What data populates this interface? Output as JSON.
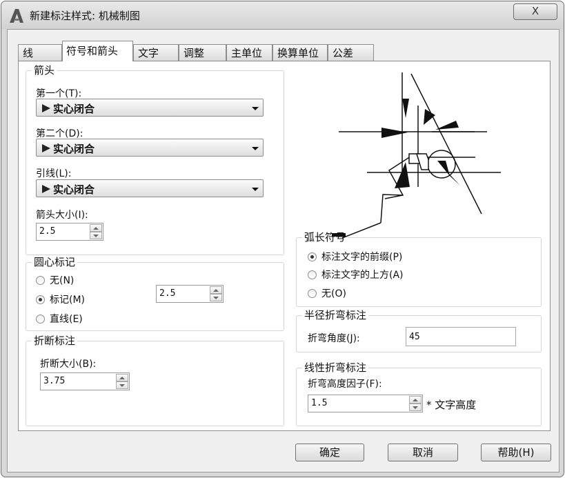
{
  "window": {
    "title": "新建标注样式: 机械制图",
    "close_label": "X"
  },
  "tabs": [
    {
      "label": "线"
    },
    {
      "label": "符号和箭头",
      "active": true
    },
    {
      "label": "文字"
    },
    {
      "label": "调整"
    },
    {
      "label": "主单位"
    },
    {
      "label": "换算单位"
    },
    {
      "label": "公差"
    }
  ],
  "arrowheads": {
    "group_label": "箭头",
    "first_label": "第一个(T):",
    "first_value": "实心闭合",
    "second_label": "第二个(D):",
    "second_value": "实心闭合",
    "leader_label": "引线(L):",
    "leader_value": "实心闭合",
    "size_label": "箭头大小(I):",
    "size_value": "2.5"
  },
  "center_marks": {
    "group_label": "圆心标记",
    "options": [
      {
        "label": "无(N)",
        "selected": false
      },
      {
        "label": "标记(M)",
        "selected": true
      },
      {
        "label": "直线(E)",
        "selected": false
      }
    ],
    "size_value": "2.5"
  },
  "dim_break": {
    "group_label": "折断标注",
    "size_label": "折断大小(B):",
    "size_value": "3.75"
  },
  "arc_length": {
    "group_label": "弧长符号",
    "options": [
      {
        "label": "标注文字的前缀(P)",
        "selected": true
      },
      {
        "label": "标注文字的上方(A)",
        "selected": false
      },
      {
        "label": "无(O)",
        "selected": false
      }
    ]
  },
  "radius_jog": {
    "group_label": "半径折弯标注",
    "angle_label": "折弯角度(J):",
    "angle_value": "45"
  },
  "linear_jog": {
    "group_label": "线性折弯标注",
    "height_label": "折弯高度因子(F):",
    "height_value": "1.5",
    "unit_label": "* 文字高度"
  },
  "buttons": {
    "ok": "确定",
    "cancel": "取消",
    "help": "帮助(H)"
  }
}
